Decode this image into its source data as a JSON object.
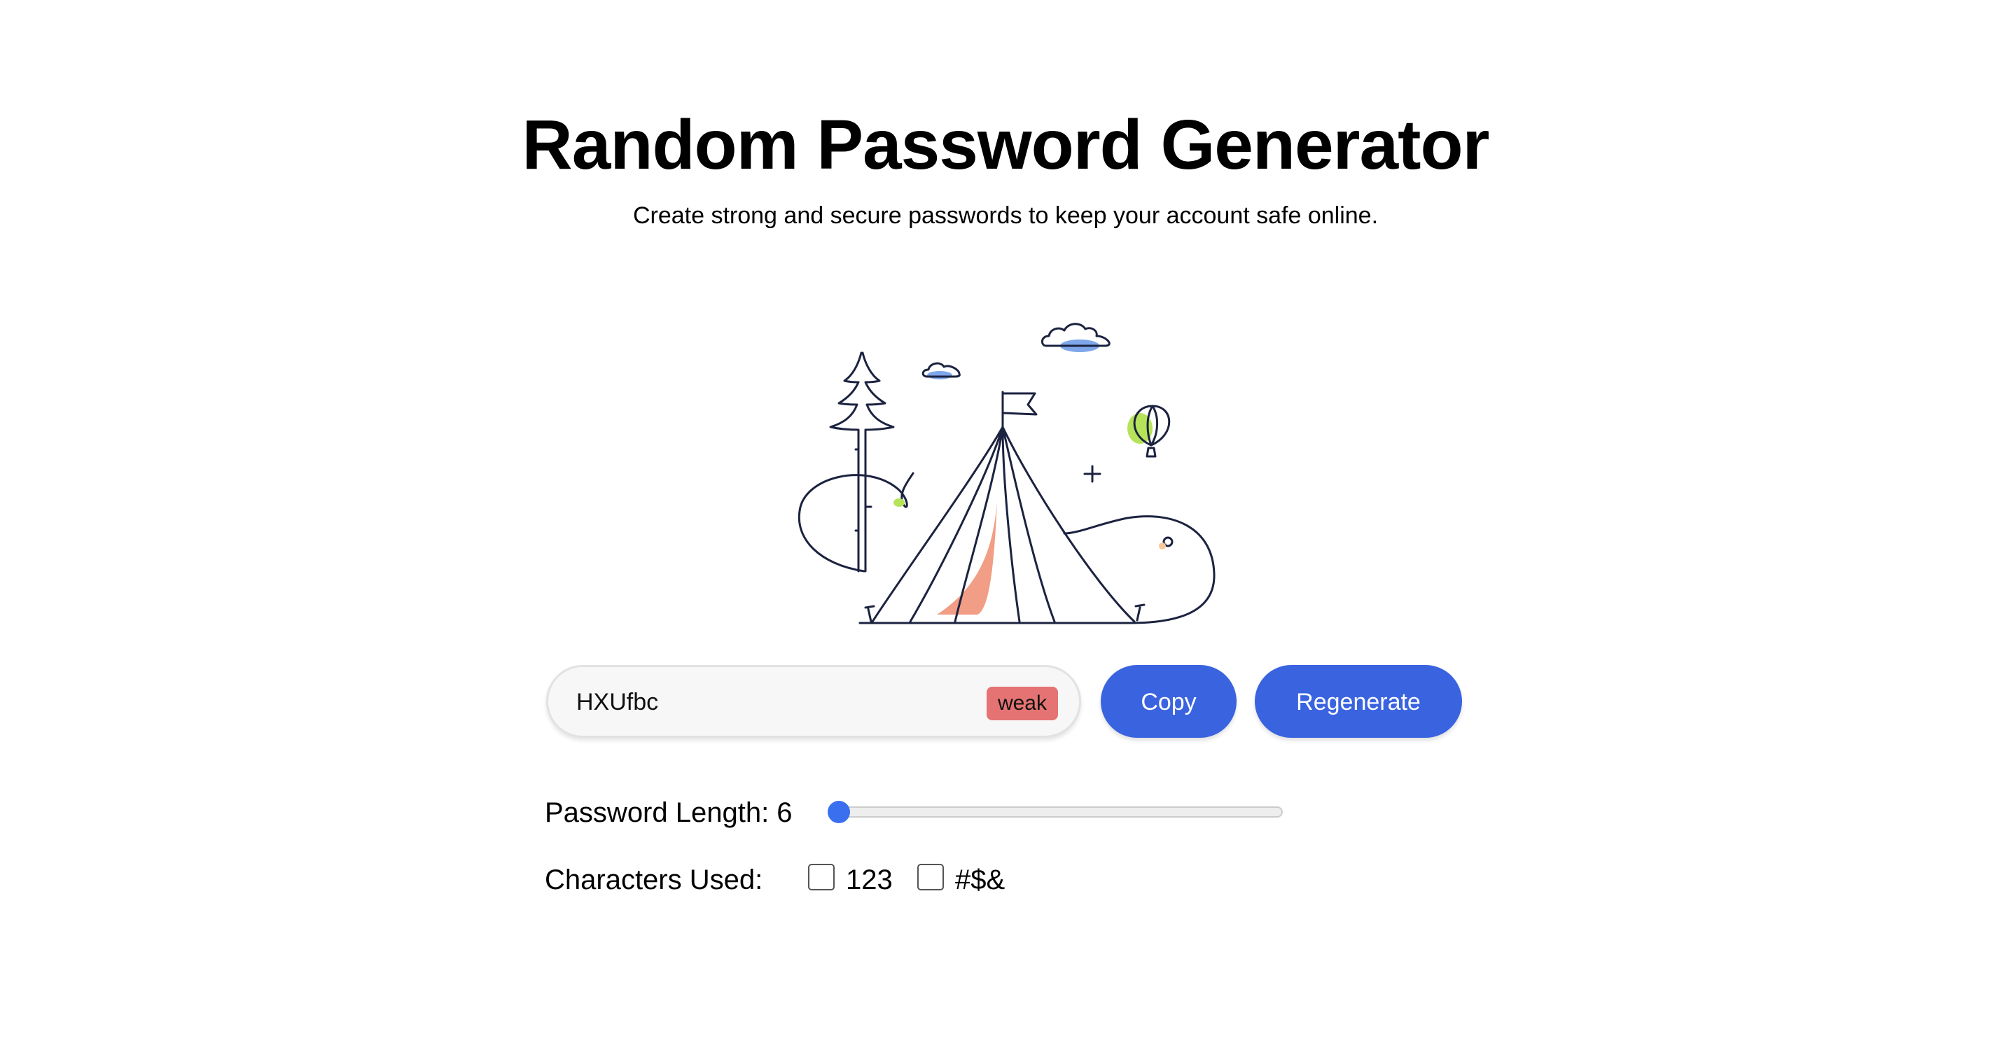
{
  "header": {
    "title": "Random Password Generator",
    "subtitle": "Create strong and secure passwords to keep your account safe online."
  },
  "password": {
    "value": "HXUfbc",
    "strength": "weak"
  },
  "buttons": {
    "copy_label": "Copy",
    "regenerate_label": "Regenerate"
  },
  "length": {
    "label": "Password Length: 6",
    "value": 6,
    "slider_fraction": 0.0
  },
  "characters": {
    "label": "Characters Used:",
    "options": [
      {
        "label": "123",
        "checked": false
      },
      {
        "label": "#$&",
        "checked": false
      }
    ]
  },
  "colors": {
    "accent": "#3a63e0",
    "weak_badge": "#e57373",
    "tent_flap": "#f29d85",
    "balloon": "#b6e35a",
    "cloud_fill": "#7ea6ea"
  },
  "icons": {
    "illustration": "camping-tent-illustration"
  }
}
